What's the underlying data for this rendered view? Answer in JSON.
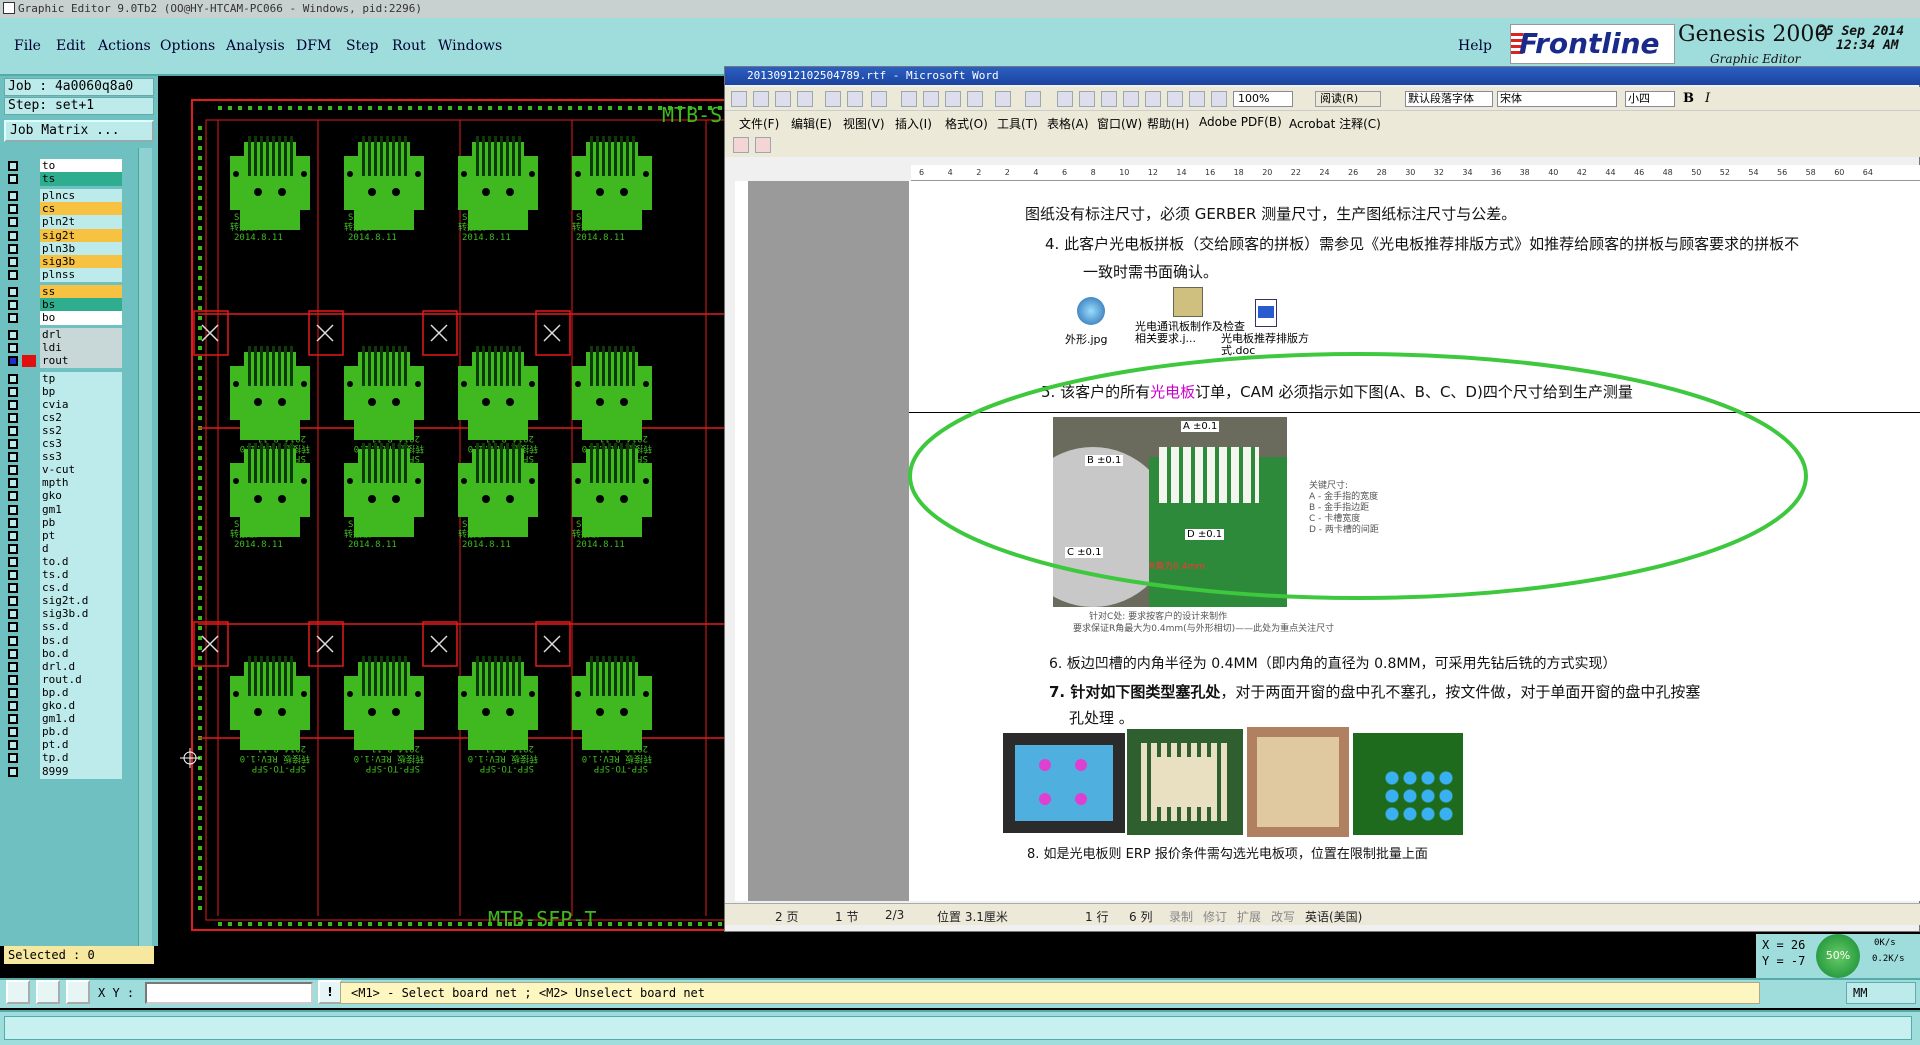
{
  "window_title": "Graphic Editor 9.0Tb2 (OO@HY-HTCAM-PC066 - Windows, pid:2296)",
  "menu": [
    "File",
    "Edit",
    "Actions",
    "Options",
    "Analysis",
    "DFM",
    "Step",
    "Rout",
    "Windows"
  ],
  "help_label": "Help",
  "brand": {
    "logo": "Frontline",
    "product": "Genesis 2000",
    "subtitle": "Graphic Editor",
    "date": "25 Sep 2014",
    "time": "12:34 AM"
  },
  "job": {
    "job_label": "Job : 4a0060q8a0",
    "step_label": "Step: set+1",
    "matrix_button": "Job Matrix ..."
  },
  "layers": [
    {
      "name": "to",
      "color": "#ffffff"
    },
    {
      "name": "ts",
      "color": "#2fae8f"
    },
    {
      "name": "plncs",
      "color": "#bdeaea"
    },
    {
      "name": "cs",
      "color": "#f7c242"
    },
    {
      "name": "pln2t",
      "color": "#bdeaea"
    },
    {
      "name": "sig2t",
      "color": "#f7c242"
    },
    {
      "name": "pln3b",
      "color": "#bdeaea"
    },
    {
      "name": "sig3b",
      "color": "#f7c242"
    },
    {
      "name": "plnss",
      "color": "#bdeaea"
    },
    {
      "name": "ss",
      "color": "#f7c242"
    },
    {
      "name": "bs",
      "color": "#2fae8f"
    },
    {
      "name": "bo",
      "color": "#ffffff"
    },
    {
      "name": "drl",
      "color": "#c8d8d8"
    },
    {
      "name": "ldi",
      "color": "#c8d8d8"
    },
    {
      "name": "rout",
      "color": "#c8d8d8"
    },
    {
      "name": "tp",
      "color": "#bdeaea"
    },
    {
      "name": "bp",
      "color": "#bdeaea"
    },
    {
      "name": "cvia",
      "color": "#bdeaea"
    },
    {
      "name": "cs2",
      "color": "#bdeaea"
    },
    {
      "name": "ss2",
      "color": "#bdeaea"
    },
    {
      "name": "cs3",
      "color": "#bdeaea"
    },
    {
      "name": "ss3",
      "color": "#bdeaea"
    },
    {
      "name": "v-cut",
      "color": "#bdeaea"
    },
    {
      "name": "mpth",
      "color": "#bdeaea"
    },
    {
      "name": "gko",
      "color": "#bdeaea"
    },
    {
      "name": "gm1",
      "color": "#bdeaea"
    },
    {
      "name": "pb",
      "color": "#bdeaea"
    },
    {
      "name": "pt",
      "color": "#bdeaea"
    },
    {
      "name": "d",
      "color": "#bdeaea"
    },
    {
      "name": "to.d",
      "color": "#bdeaea"
    },
    {
      "name": "ts.d",
      "color": "#bdeaea"
    },
    {
      "name": "cs.d",
      "color": "#bdeaea"
    },
    {
      "name": "sig2t.d",
      "color": "#bdeaea"
    },
    {
      "name": "sig3b.d",
      "color": "#bdeaea"
    },
    {
      "name": "ss.d",
      "color": "#bdeaea"
    },
    {
      "name": "bs.d",
      "color": "#bdeaea"
    },
    {
      "name": "bo.d",
      "color": "#bdeaea"
    },
    {
      "name": "drl.d",
      "color": "#bdeaea"
    },
    {
      "name": "rout.d",
      "color": "#bdeaea"
    },
    {
      "name": "bp.d",
      "color": "#bdeaea"
    },
    {
      "name": "gko.d",
      "color": "#bdeaea"
    },
    {
      "name": "gm1.d",
      "color": "#bdeaea"
    },
    {
      "name": "pb.d",
      "color": "#bdeaea"
    },
    {
      "name": "pt.d",
      "color": "#bdeaea"
    },
    {
      "name": "tp.d",
      "color": "#bdeaea"
    },
    {
      "name": "8999",
      "color": "#bdeaea"
    }
  ],
  "selected_label": "Selected : 0",
  "xy_label": "X Y :",
  "prompt": "<M1> - Select board net ; <M2> Unselect board net",
  "units": "MM",
  "coords": {
    "x": "X = 26",
    "y": "Y = -7"
  },
  "net_meter": {
    "percent": "50%",
    "up": "0K/s",
    "down": "0.2K/s"
  },
  "pcb": {
    "panel_label": "MTB-SFP-T",
    "unit_text_1": "SFP-TO-SFP",
    "unit_text_2": "转接板 REV:1.0",
    "unit_date": "2014.8.11"
  },
  "word": {
    "title": "20130912102504789.rtf - Microsoft Word",
    "menu": [
      "文件(F)",
      "编辑(E)",
      "视图(V)",
      "插入(I)",
      "格式(O)",
      "工具(T)",
      "表格(A)",
      "窗口(W)",
      "帮助(H)",
      "Adobe PDF(B)",
      "Acrobat 注释(C)"
    ],
    "zoom": "100%",
    "read_btn": "阅读(R)",
    "style": "默认段落字体",
    "font": "宋体",
    "size": "小四",
    "ruler": [
      "6",
      "4",
      "2",
      "2",
      "4",
      "6",
      "8",
      "10",
      "12",
      "14",
      "16",
      "18",
      "20",
      "22",
      "24",
      "26",
      "28",
      "30",
      "32",
      "34",
      "36",
      "38",
      "40",
      "42",
      "44",
      "46",
      "48",
      "50",
      "52",
      "54",
      "56",
      "58",
      "60",
      "64"
    ],
    "text_top": "图纸没有标注尺寸，必须 GERBER 测量尺寸，生产图纸标注尺寸与公差。",
    "item4a": "4.  此客户光电板拼板（交给顾客的拼板）需参见《光电板推荐排版方式》如推荐给顾客的拼板与顾客要求的拼板不",
    "item4b": "一致时需书面确认。",
    "files": [
      "外形.jpg",
      "光电通讯板制作及检查相关要求.j...",
      "光电板推荐排版方式.doc"
    ],
    "item5_pre": "5.  该客户的所有",
    "item5_hl": "光电板",
    "item5_post": "订单，CAM 必须指示如下图(A、B、C、D)四个尺寸给到生产测量",
    "img_labels": {
      "a": "A ±0.1",
      "b": "B ±0.1",
      "c": "C ±0.1",
      "d": "D ±0.1"
    },
    "key_dims": [
      "关键尺寸:",
      "A - 金手指的宽度",
      "B - 金手指边距",
      "C - 卡槽宽度",
      "D - 两卡槽的间距"
    ],
    "cap1": "针对C处: 要求按客户的设计来制作",
    "cap2": "要求保证R角最大为0.4mm(与外形相切)——此处为重点关注尺寸",
    "r_note": "R角为0.4mm",
    "item6": "6.  板边凹槽的内角半径为 0.4MM（即内角的直径为 0.8MM，可采用先钻后铣的方式实现）",
    "item7_bold": "7.  针对如下图类型塞孔处",
    "item7_rest": "，对于两面开窗的盘中孔不塞孔，按文件做，对于单面开窗的盘中孔按塞",
    "item7b": "孔处理 。",
    "item8": "8. 如是光电板则 ERP 报价条件需勾选光电板项，位置在限制批量上面",
    "status": [
      "2 页",
      "1 节",
      "2/3",
      "位置 3.1厘米",
      "1 行",
      "6 列",
      "录制",
      "修订",
      "扩展",
      "改写",
      "英语(美国)"
    ]
  },
  "colors": {
    "pcb_green": "#3fb91f",
    "pcb_red": "#e31b1b",
    "highlight_circle": "#3ec83e",
    "cyan_bg": "#9fdcdc"
  }
}
